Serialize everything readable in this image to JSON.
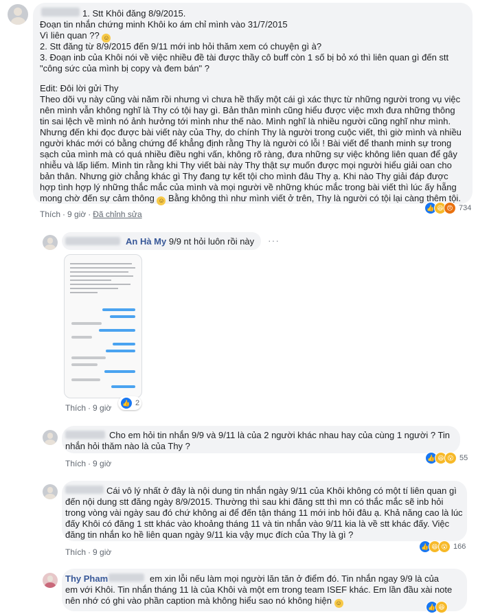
{
  "comment1": {
    "lines": [
      "1. Stt Khôi đăng 8/9/2015.",
      "Đoạn tin nhắn chứng minh Khôi ko ám chỉ mình vào 31/7/2015",
      "Vì liên quan ?? ",
      "2. Stt đăng từ 8/9/2015 đến 9/11 mới inb hỏi thăm xem có chuyện gì à?",
      "3. Đoạn inb của Khôi nói về việc nhiều đề tài được thầy cô buff còn 1 số bị bỏ xó thì liên quan gì đến stt",
      "\"công sức của mình bị copy và đem bán\" ?",
      "",
      "Edit: Đôi lời gửi Thy",
      "Theo dõi vụ này cũng vài năm rồi nhưng vì chưa hề thấy một cái gì xác thực từ những người trong vụ việc",
      "nên mình vẫn không nghĩ là Thy có tội hay gì. Bản thân mình cũng hiểu được việc mxh đưa những thông",
      "tin sai lệch về mình nó ảnh hưởng tới mình như thế nào. Mình nghĩ là nhiều người cũng nghĩ như mình.",
      "Nhưng đến khi đọc được bài viết này của Thy, do chính Thy là người trong cuộc viết, thì giờ mình và nhiều",
      "người khác mới có bằng chứng để khẳng định rằng Thy là người có lỗi ! Bài viết để thanh minh sự trong",
      "sạch của mình mà có quá nhiều điều nghi vấn, không rõ ràng, đưa những sự việc không liên quan để gây",
      "nhiễu và lấp liếm. Mình tin rằng khi Thy viết bài này Thy thật sự muốn được mọi người hiểu giải oan cho",
      "bản thân. Nhưng giờ chẳng khác gì Thy đang tự kết tội cho mình đâu Thy ạ. Khi nào Thy giải đáp được",
      "hợp tình hợp lý những thắc mắc của mình và mọi người về những khúc mắc trong bài viết thì lúc ấy hẵng",
      "mong chờ đến sự cảm thông ",
      " Bằng không thì như mình viết ở trên, Thy là người có tội lại càng thêm tội."
    ],
    "like": "Thích",
    "time": "9 giờ",
    "edited": "Đã chỉnh sửa",
    "reactions": "734"
  },
  "reply1": {
    "author": "An Hà My",
    "text": "9/9 nt hỏi luôn rồi này",
    "like": "Thích",
    "time": "9 giờ",
    "reactions": "2"
  },
  "reply2": {
    "lines": [
      "Cho em hỏi tin nhắn 9/9 và 9/11 là của 2 người khác nhau hay của cùng 1 người ? Tin",
      "nhắn hỏi thăm nào là của Thy ?"
    ],
    "like": "Thích",
    "time": "9 giờ",
    "reactions": "55"
  },
  "reply3": {
    "lines": [
      "Cái vô lý nhất ở đây là nội dung tin nhắn ngày 9/11 của Khôi không có một tí liên quan gì",
      "đến nội dung stt đăng ngày 8/9/2015. Thường thì sau khi đăng stt thì mn có thắc mắc sẽ inb hỏi",
      "trong vòng vài ngày sau đó chứ không ai để đến tận tháng 11 mới inb hỏi đâu ạ. Khả năng cao là lúc",
      "đấy Khôi có đăng 1 stt khác vào khoảng tháng 11 và tin nhắn vào 9/11 kia là về stt khác đấy. Việc",
      "đăng tin nhắn ko hề liên quan ngày 9/11 kia vậy mục đích của Thy là gì ?"
    ],
    "like": "Thích",
    "time": "9 giờ",
    "reactions": "166"
  },
  "reply4": {
    "author": "Thy Pham",
    "lines": [
      "em xin lỗi nếu làm mọi người lăn tăn ở điểm đó. Tin nhắn ngay 9/9 là của",
      "em với Khôi. Tin nhắn tháng 11 là của Khôi và một em trong team ISEF khác. Em lần đầu xài note",
      "nên nhớ có ghi vào phần caption mà không hiểu sao nó không hiện "
    ]
  },
  "more_label": "···"
}
